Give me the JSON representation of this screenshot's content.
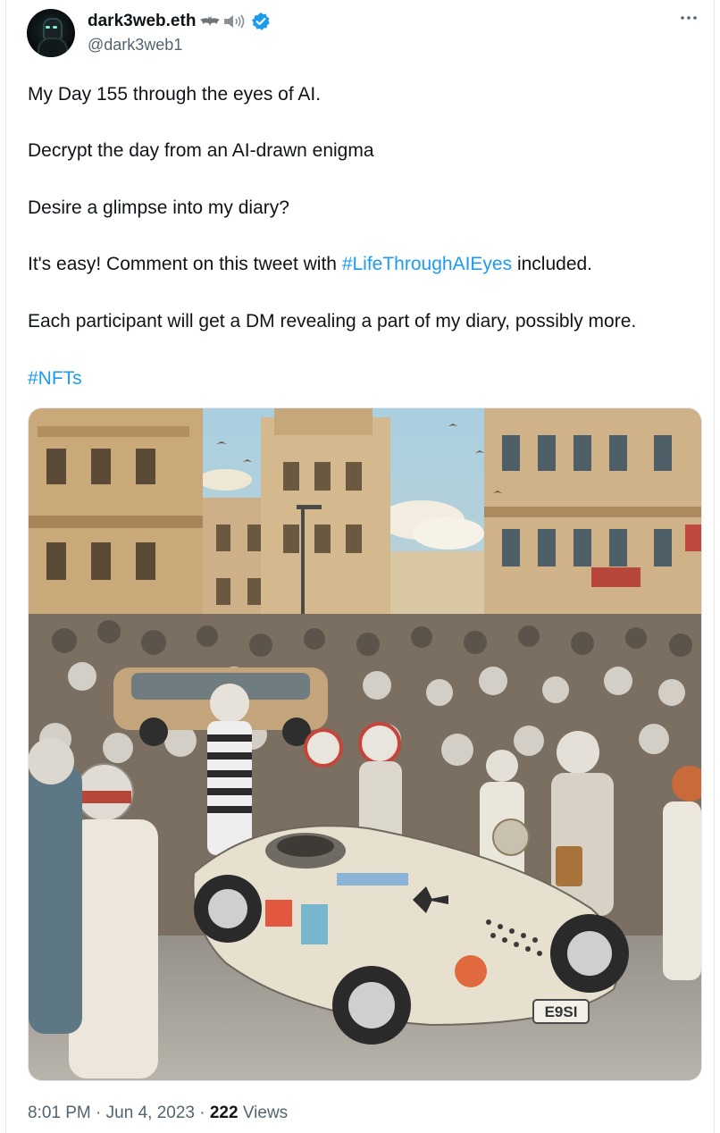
{
  "tweet": {
    "author": {
      "display_name": "dark3web.eth",
      "name_emojis": [
        "bat-emoji",
        "speaker-emoji"
      ],
      "verified": true,
      "handle": "@dark3web1",
      "avatar_icon": "hooded-figure-avatar"
    },
    "more_icon": "more-dots-icon",
    "lines": {
      "line1": "My Day 155 through the eyes of AI.",
      "line2": "Decrypt the day from an AI-drawn enigma",
      "line3": "Desire a glimpse into my diary?",
      "line4_before": "It's easy! Comment on this tweet with ",
      "line4_hashtag": "#LifeThroughAIEyes",
      "line4_after": " included.",
      "line5": "Each participant will get a DM revealing a part of my diary, possibly more.",
      "line6_hashtag": "#NFTs"
    },
    "media": {
      "type": "image",
      "subject": "AI-drawn painting of a crowd of racing drivers in helmets around a white vintage race car in a city square",
      "car_plate": "E9SI"
    },
    "meta": {
      "time": "8:01 PM",
      "separator": "·",
      "date": "Jun 4, 2023",
      "views_count": "222",
      "views_label": "Views"
    },
    "colors": {
      "accent": "#1d9bf0",
      "text": "#0f1419",
      "secondary": "#536471"
    }
  }
}
